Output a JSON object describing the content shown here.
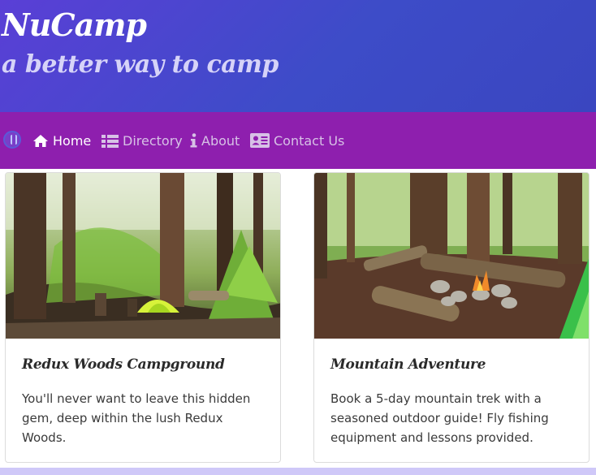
{
  "header": {
    "brand": "NuCamp",
    "tagline": "a better way to camp"
  },
  "nav": {
    "items": [
      {
        "label": "Home",
        "icon": "home-icon",
        "active": true
      },
      {
        "label": "Directory",
        "icon": "list-icon",
        "active": false
      },
      {
        "label": "About",
        "icon": "info-icon",
        "active": false
      },
      {
        "label": "Contact Us",
        "icon": "address-card-icon",
        "active": false
      }
    ]
  },
  "cards": [
    {
      "title": "Redux Woods Campground",
      "text": "You'll never want to leave this hidden gem, deep within the lush Redux Woods."
    },
    {
      "title": "Mountain Adventure",
      "text": "Book a 5-day mountain trek with a seasoned outdoor guide! Fly fishing equipment and lessons provided."
    }
  ],
  "colors": {
    "jumbotron": "#3d4cc8",
    "navbar": "#8e1fae",
    "footer_band": "#cfc8f8"
  }
}
